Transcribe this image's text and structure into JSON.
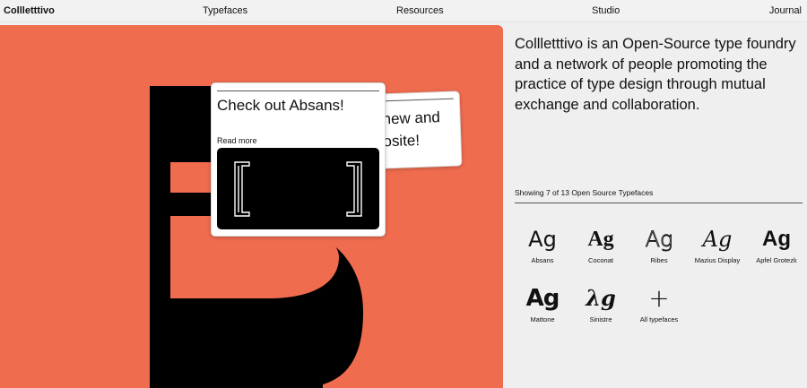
{
  "nav": {
    "brand": "Collletttivo",
    "items": [
      "Typefaces",
      "Resources",
      "Studio",
      "Journal"
    ]
  },
  "hero": {
    "background_color": "#ef6c4f",
    "letter_color": "#000000",
    "front_card": {
      "title": "Check out Absans!",
      "read_more": "Read more"
    },
    "back_card": {
      "text_lines": [
        "new and",
        "osite!"
      ]
    }
  },
  "info": {
    "about": "Collletttivo is an Open-Source type foundry and a network of people promoting the practice of type design through mutual exchange and collaboration.",
    "count_label": "Showing 7 of 13 Open Source Typefaces",
    "typefaces": [
      {
        "glyph": "Ag",
        "name": "Absans"
      },
      {
        "glyph": "Ag",
        "name": "Coconat"
      },
      {
        "glyph": "Ag",
        "name": "Ribes"
      },
      {
        "glyph": "Ag",
        "name": "Mazius Display"
      },
      {
        "glyph": "Ag",
        "name": "Apfel Grotezk"
      },
      {
        "glyph": "Ag",
        "name": "Mattone"
      },
      {
        "glyph": "λg",
        "name": "Sinistre"
      },
      {
        "glyph": "+",
        "name": "All typefaces"
      }
    ]
  }
}
